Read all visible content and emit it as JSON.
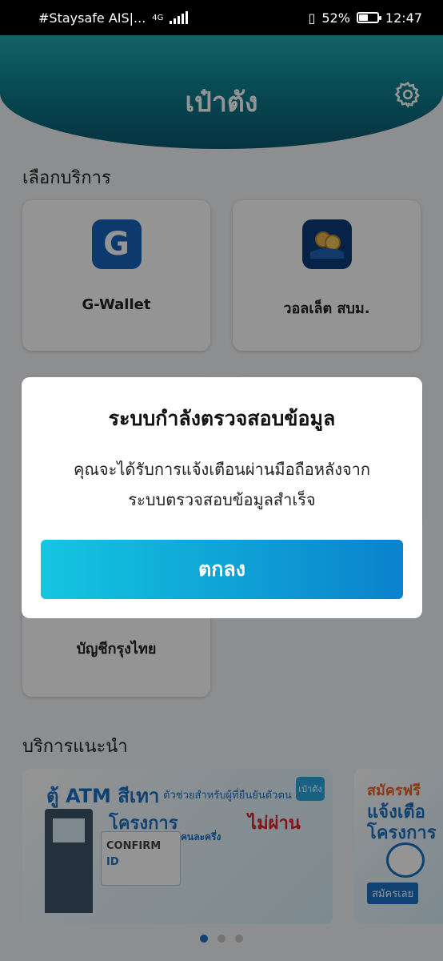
{
  "status_bar": {
    "carrier": "#Staysafe AIS|...",
    "network": "4G",
    "battery": "52%",
    "battery_level": 0.52,
    "time": "12:47"
  },
  "header": {
    "title": "เป๋าตัง",
    "settings_icon": "gear-icon"
  },
  "services": {
    "title": "เลือกบริการ",
    "items": [
      {
        "label": "G-Wallet",
        "icon": "g-wallet-icon",
        "color": "#1565c0"
      },
      {
        "label": "วอลเล็ต สบม.",
        "icon": "wallet-coins-icon",
        "color": "#0d3c7a"
      },
      {
        "label": "บัญชีกรุงไทย",
        "icon": "bank-icon"
      }
    ]
  },
  "recommended": {
    "title": "บริการแนะนำ",
    "banner1": {
      "title": "ตู้ ATM สีเทา",
      "subtitle": "ตัวช่วยสำหรับผู้ที่ยืนยันตัวตน",
      "project": "โครงการ",
      "fail": "ไม่ผ่าน",
      "tag": "คนละครึ่ง",
      "logo": "เป๋าตัง",
      "confirm_line1": "CONFIRM",
      "confirm_line2": "ID"
    },
    "banner2": {
      "line1": "สมัครฟรี",
      "line2": "แจ้งเตือ",
      "line3": "โครงการ",
      "button": "สมัครเลย"
    },
    "pagination": {
      "count": 3,
      "active": 0
    }
  },
  "dialog": {
    "title": "ระบบกำลังตรวจสอบข้อมูล",
    "message_line1": "คุณจะได้รับการแจ้งเตือนผ่านมือถือหลังจาก",
    "message_line2": "ระบบตรวจสอบข้อมูลสำเร็จ",
    "ok_button": "ตกลง"
  },
  "colors": {
    "header": "#0c7a8a",
    "accent": "#1a73c5",
    "button_start": "#14c6e0",
    "button_end": "#0a82cd"
  }
}
